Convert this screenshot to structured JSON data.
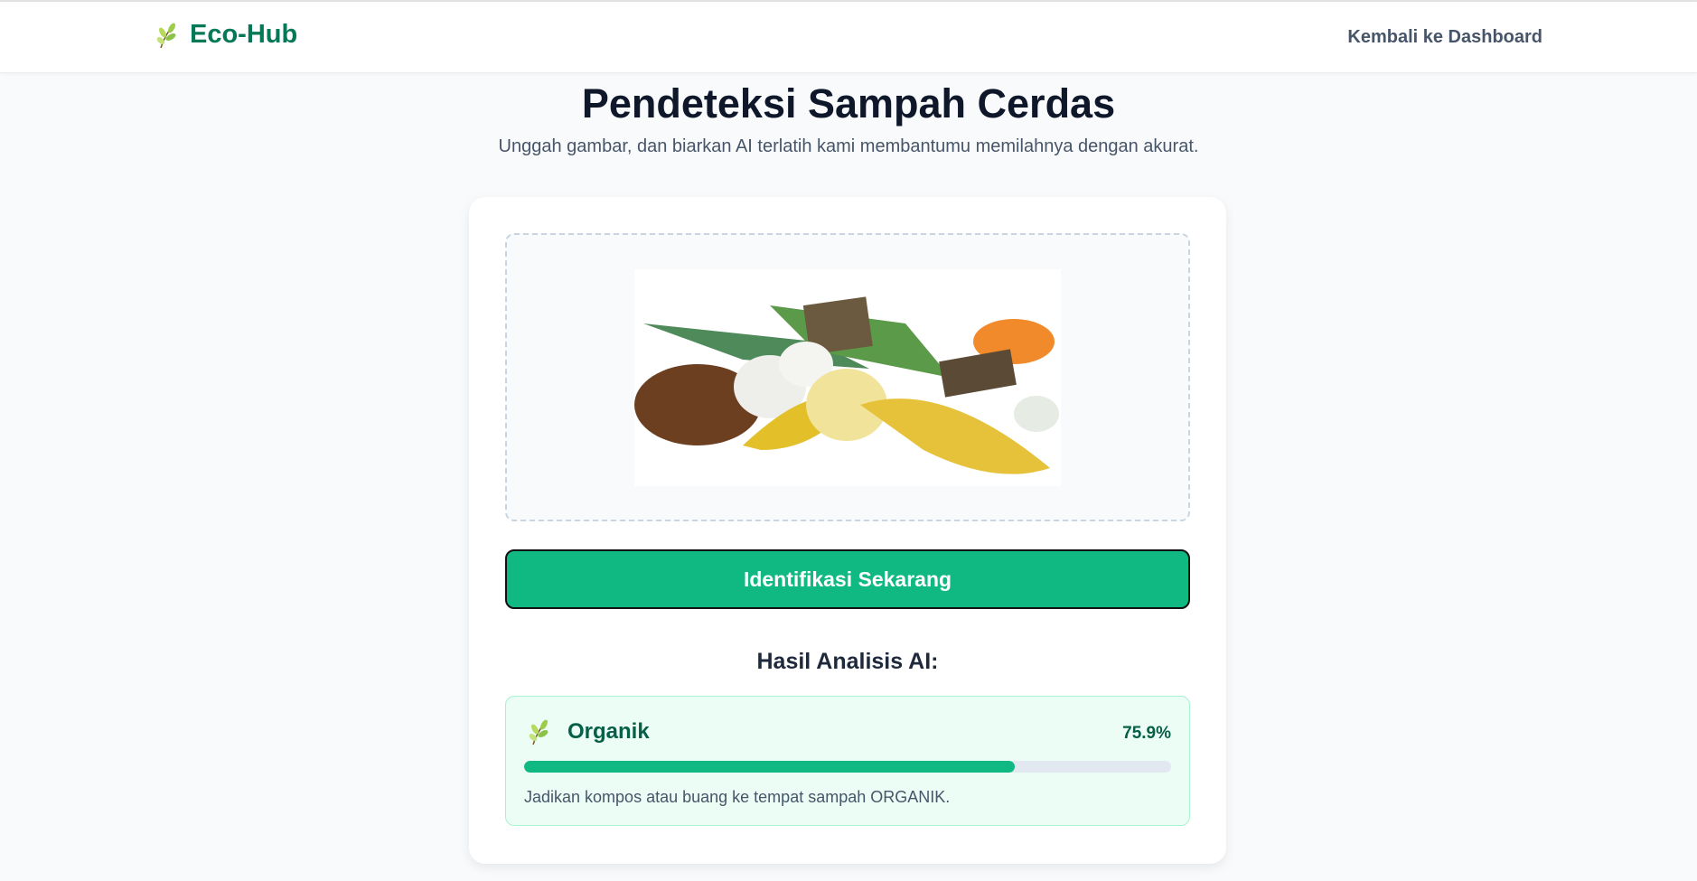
{
  "header": {
    "brand": "Eco-Hub",
    "brand_icon": "herb-icon",
    "back_link": "Kembali ke Dashboard"
  },
  "page": {
    "title": "Pendeteksi Sampah Cerdas",
    "subtitle": "Unggah gambar, dan biarkan AI terlatih kami membantumu memilahnya dengan akurat."
  },
  "upload": {
    "preview_image": "organic-waste-photo"
  },
  "button": {
    "label": "Identifikasi Sekarang"
  },
  "result": {
    "heading": "Hasil Analisis AI:",
    "category": "Organik",
    "icon": "herb-icon",
    "confidence_label": "75.9%",
    "confidence": 75.9,
    "advice": "Jadikan kompos atau buang ke tempat sampah ORGANIK.",
    "colors": {
      "accent": "#10b981",
      "text": "#065f46",
      "bg": "#ecfdf5"
    }
  }
}
